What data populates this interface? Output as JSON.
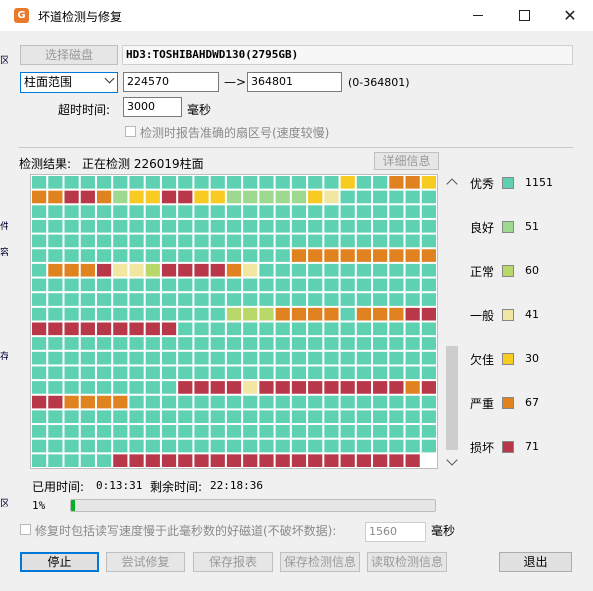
{
  "window": {
    "title": "坏道检测与修复"
  },
  "disk": {
    "select_button": "选择磁盘",
    "name": "HD3:TOSHIBAHDWD130(2795GB)"
  },
  "range": {
    "mode": "柱面范围",
    "start": "224570",
    "arrow": "—>",
    "end": "364801",
    "hint": "(0-364801)"
  },
  "timeout": {
    "label": "超时时间:",
    "value": "3000",
    "unit": "毫秒"
  },
  "options": {
    "report_sector_label": "检测时报告准确的扇区号(速度较慢)"
  },
  "result": {
    "label": "检测结果:",
    "status": "正在检测 226019柱面",
    "detail_button": "详细信息"
  },
  "colors": {
    "excellent": "#5fd1b3",
    "good": "#9dd98e",
    "normal": "#b9d86a",
    "fair": "#f1e6a2",
    "poor": "#f7cb22",
    "serious": "#e0821f",
    "bad": "#b8384a",
    "unscanned": "#ffffff"
  },
  "legend": [
    {
      "key": "excellent",
      "label": "优秀",
      "count": "1151"
    },
    {
      "key": "good",
      "label": "良好",
      "count": "51"
    },
    {
      "key": "normal",
      "label": "正常",
      "count": "60"
    },
    {
      "key": "fair",
      "label": "一般",
      "count": "41"
    },
    {
      "key": "poor",
      "label": "欠佳",
      "count": "30"
    },
    {
      "key": "serious",
      "label": "严重",
      "count": "67"
    },
    {
      "key": "bad",
      "label": "损坏",
      "count": "71"
    }
  ],
  "block_grid": {
    "columns": 25,
    "rows": [
      "EEEEEEEEEEEEEEEEEEEPYYSSP",
      "SSBBSGPPBBPPGGGGGPFEEEEEE",
      "EEEEEEEEEEEEEEEEEEEEEEEEE",
      "EEEEEEEEEEEEEEEEEEEEEEEEE",
      "EEEEEEEEEEEEEEEEEEEEEEEEE",
      "EEEEEEEEEEEEEEEESSSSSSSSS",
      "YSSSBFFNBBBBSFEEEEEEEEEEE",
      "EEEEEEEEEEEEEEEEEEEEEEEEE",
      "EEEEEEEEEEEEEEEEEEEEEEEEE",
      "EEEEEEEEEEEENNNSSSSESSSBB",
      "BBBBBBBBBEEEEEEEEEEEEEEEE",
      "EEEEEEEEEEEEEEEEEEEEEEEEE",
      "EEEEEEEEEEEEEEEEEEEEEEEEE",
      "EEEEEEEEEEEEEEEEEEEEEEEEE",
      "EEEEEEEEEBBBBFBBBBBBBBBSB",
      "BBSSSSEEEEEEEEEEEEEEEEEEE",
      "EEEEEEEEEEEEEEEEEEEEEEEEE",
      "EEEEEEEEEEEEEEEEEEEEEEEEE",
      "EEEEEEEEEEEEEEEEEEEEEEEEE",
      "EEEEEBBBBBBBBBBBBBBBBBBBU"
    ]
  },
  "time": {
    "elapsed_label": "已用时间:",
    "elapsed": "0:13:31",
    "remaining_label": "剩余时间:",
    "remaining": "22:18:36"
  },
  "progress": {
    "percent_text": "1%",
    "fraction": 0.01
  },
  "repair_option": {
    "label": "修复时包括读写速度慢于此毫秒数的好磁道(不破坏数据):",
    "value": "1560",
    "unit": "毫秒"
  },
  "buttons": {
    "stop": "停止",
    "try_repair": "尝试修复",
    "save_report": "保存报表",
    "save_info": "保存检测信息",
    "load_info": "读取检测信息",
    "exit": "退出"
  }
}
